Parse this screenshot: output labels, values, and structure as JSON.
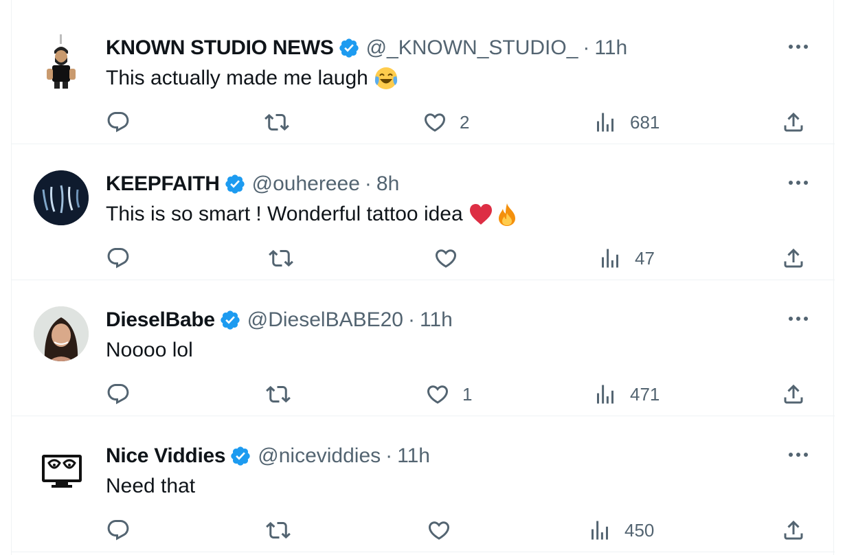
{
  "tweets": [
    {
      "name": "KNOWN STUDIO NEWS",
      "handle": "@_KNOWN_STUDIO_",
      "time": "11h",
      "text": "This actually made me laugh",
      "emojis": [
        "face-with-tears-of-joy-emoji"
      ],
      "likes": "2",
      "views": "681"
    },
    {
      "name": "KEEPFAITH",
      "handle": "@ouhereee",
      "time": "8h",
      "text": "This is so smart ! Wonderful tattoo idea",
      "emojis": [
        "red-heart-emoji",
        "fire-emoji"
      ],
      "likes": "",
      "views": "47"
    },
    {
      "name": "DieselBabe",
      "handle": "@DieselBABE20",
      "time": "11h",
      "text": "Noooo lol",
      "emojis": [],
      "likes": "1",
      "views": "471"
    },
    {
      "name": "Nice Viddies",
      "handle": "@niceviddies",
      "time": "11h",
      "text": "Need that",
      "emojis": [],
      "likes": "",
      "views": "450"
    }
  ],
  "separator": "·",
  "colors": {
    "text": "#0f1419",
    "secondary": "#536471",
    "verified": "#1d9bf0",
    "divider": "#eff3f4"
  },
  "icons": [
    "reply-icon",
    "retweet-icon",
    "like-icon",
    "views-icon",
    "share-icon",
    "more-icon",
    "verified-badge-icon"
  ]
}
